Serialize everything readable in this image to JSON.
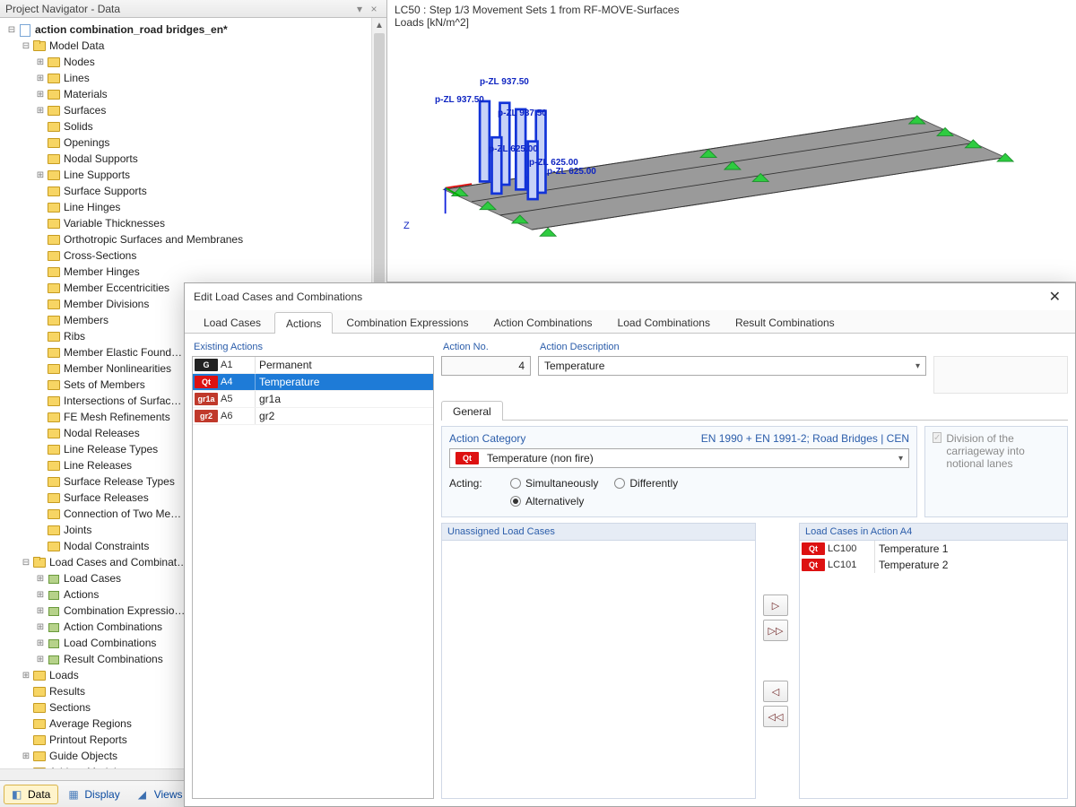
{
  "navigator": {
    "title": "Project Navigator - Data",
    "root": "action combination_road bridges_en*",
    "model_data": "Model Data",
    "items": [
      "Nodes",
      "Lines",
      "Materials",
      "Surfaces",
      "Solids",
      "Openings",
      "Nodal Supports",
      "Line Supports",
      "Surface Supports",
      "Line Hinges",
      "Variable Thicknesses",
      "Orthotropic Surfaces and Membranes",
      "Cross-Sections",
      "Member Hinges",
      "Member Eccentricities",
      "Member Divisions",
      "Members",
      "Ribs",
      "Member Elastic Found…",
      "Member Nonlinearities",
      "Sets of Members",
      "Intersections of Surfac…",
      "FE Mesh Refinements",
      "Nodal Releases",
      "Line Release Types",
      "Line Releases",
      "Surface Release Types",
      "Surface Releases",
      "Connection of Two Me…",
      "Joints",
      "Nodal Constraints"
    ],
    "lcc": "Load Cases and Combinat…",
    "lcc_items": [
      "Load Cases",
      "Actions",
      "Combination Expressio…",
      "Action Combinations",
      "Load Combinations",
      "Result Combinations"
    ],
    "tail": [
      "Loads",
      "Results",
      "Sections",
      "Average Regions",
      "Printout Reports",
      "Guide Objects",
      "Add-on Modules"
    ],
    "tabs": {
      "data": "Data",
      "display": "Display",
      "views": "Views"
    }
  },
  "viewport": {
    "line1": "LC50 : Step 1/3 Movement Sets 1 from RF-MOVE-Surfaces",
    "line2": "Loads [kN/m^2]",
    "labels": [
      "p-ZL 937.50",
      "p-ZL 937.50",
      "p-ZL 937.50",
      "p-ZL 625.00",
      "p-ZL 625.00",
      "p-ZL 625.00"
    ],
    "axis": "Z"
  },
  "dialog": {
    "title": "Edit Load Cases and Combinations",
    "tabs": [
      "Load Cases",
      "Actions",
      "Combination Expressions",
      "Action Combinations",
      "Load Combinations",
      "Result Combinations"
    ],
    "existing": "Existing Actions",
    "actions": [
      {
        "tag": "G",
        "cls": "g",
        "code": "A1",
        "desc": "Permanent"
      },
      {
        "tag": "Qt",
        "cls": "qt",
        "code": "A4",
        "desc": "Temperature"
      },
      {
        "tag": "gr1a",
        "cls": "gr1",
        "code": "A5",
        "desc": "gr1a"
      },
      {
        "tag": "gr2",
        "cls": "gr2",
        "code": "A6",
        "desc": "gr2"
      }
    ],
    "action_no_label": "Action No.",
    "action_no": "4",
    "action_desc_label": "Action Description",
    "action_desc": "Temperature",
    "general": "General",
    "cat_label": "Action Category",
    "cat_std": "EN 1990 + EN 1991-2; Road Bridges | CEN",
    "cat_value": "Temperature (non fire)",
    "acting": "Acting:",
    "radios": {
      "sim": "Simultaneously",
      "alt": "Alternatively",
      "diff": "Differently"
    },
    "division": "Division of the carriageway into notional lanes",
    "unassigned": "Unassigned Load Cases",
    "assigned": "Load Cases in Action A4",
    "lcs": [
      {
        "tag": "Qt",
        "code": "LC100",
        "desc": "Temperature 1"
      },
      {
        "tag": "Qt",
        "code": "LC101",
        "desc": "Temperature 2"
      }
    ]
  }
}
